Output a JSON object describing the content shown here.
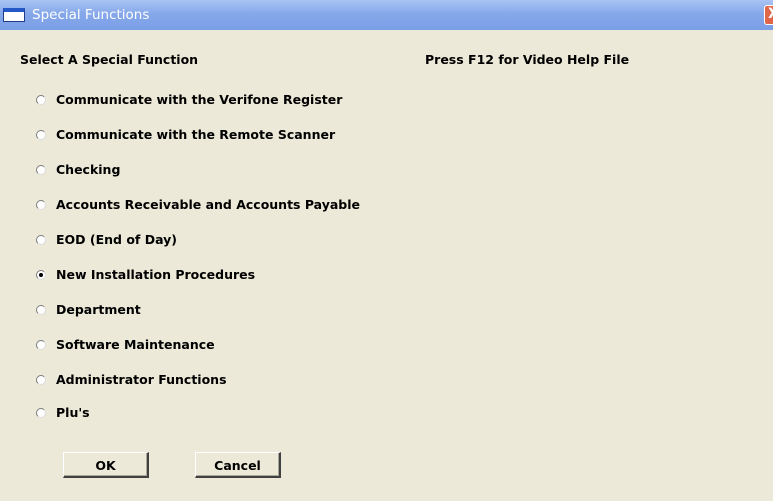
{
  "window": {
    "title": "Special Functions",
    "close_glyph": "X"
  },
  "main": {
    "heading": "Select A Special Function",
    "help_hint": "Press F12 for Video Help File",
    "options": [
      {
        "label": "Communicate with the Verifone Register",
        "selected": false
      },
      {
        "label": "Communicate with the Remote Scanner",
        "selected": false
      },
      {
        "label": "Checking",
        "selected": false
      },
      {
        "label": "Accounts Receivable and Accounts Payable",
        "selected": false
      },
      {
        "label": "EOD (End of Day)",
        "selected": false
      },
      {
        "label": "New Installation Procedures",
        "selected": true
      },
      {
        "label": "Department",
        "selected": false
      },
      {
        "label": "Software Maintenance",
        "selected": false
      },
      {
        "label": "Administrator Functions",
        "selected": false
      },
      {
        "label": "Plu's",
        "selected": false
      }
    ]
  },
  "buttons": {
    "ok_label": "OK",
    "cancel_label": "Cancel"
  },
  "colors": {
    "titlebar": "#7b9fe6",
    "face": "#ece9d8",
    "close": "#e0664a"
  }
}
